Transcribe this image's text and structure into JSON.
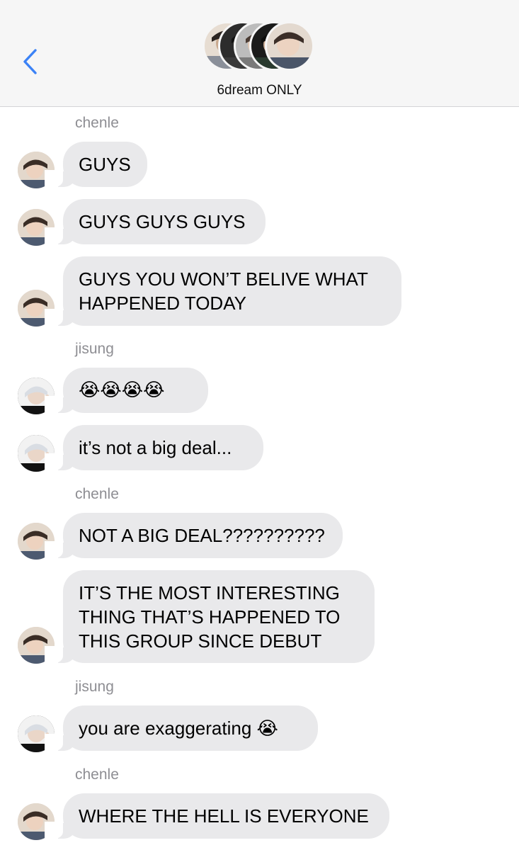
{
  "header": {
    "back_icon": "chevron-left-icon",
    "group_name": "6dream ONLY",
    "accent_color": "#3b82f6"
  },
  "participants": {
    "chenle": "chenle",
    "jisung": "jisung"
  },
  "messages": [
    {
      "sender": "chenle",
      "text": "GUYS"
    },
    {
      "sender": "chenle",
      "text": "GUYS GUYS GUYS"
    },
    {
      "sender": "chenle",
      "text": "GUYS YOU WON’T BELIVE WHAT\nHAPPENED TODAY"
    },
    {
      "sender": "jisung",
      "text": "😭😭😭😭"
    },
    {
      "sender": "jisung",
      "text": "it’s not a big deal..."
    },
    {
      "sender": "chenle",
      "text": "NOT A BIG DEAL??????????"
    },
    {
      "sender": "chenle",
      "text": "IT’S THE MOST INTERESTING\nTHING THAT’S HAPPENED TO\nTHIS GROUP SINCE DEBUT"
    },
    {
      "sender": "jisung",
      "text": "you are exaggerating 😭"
    },
    {
      "sender": "chenle",
      "text": "WHERE THE HELL IS EVERYONE"
    }
  ],
  "colors": {
    "bubble": "#e9e9eb",
    "sender_label": "#8e8e93",
    "header_bg": "#f6f6f6"
  }
}
